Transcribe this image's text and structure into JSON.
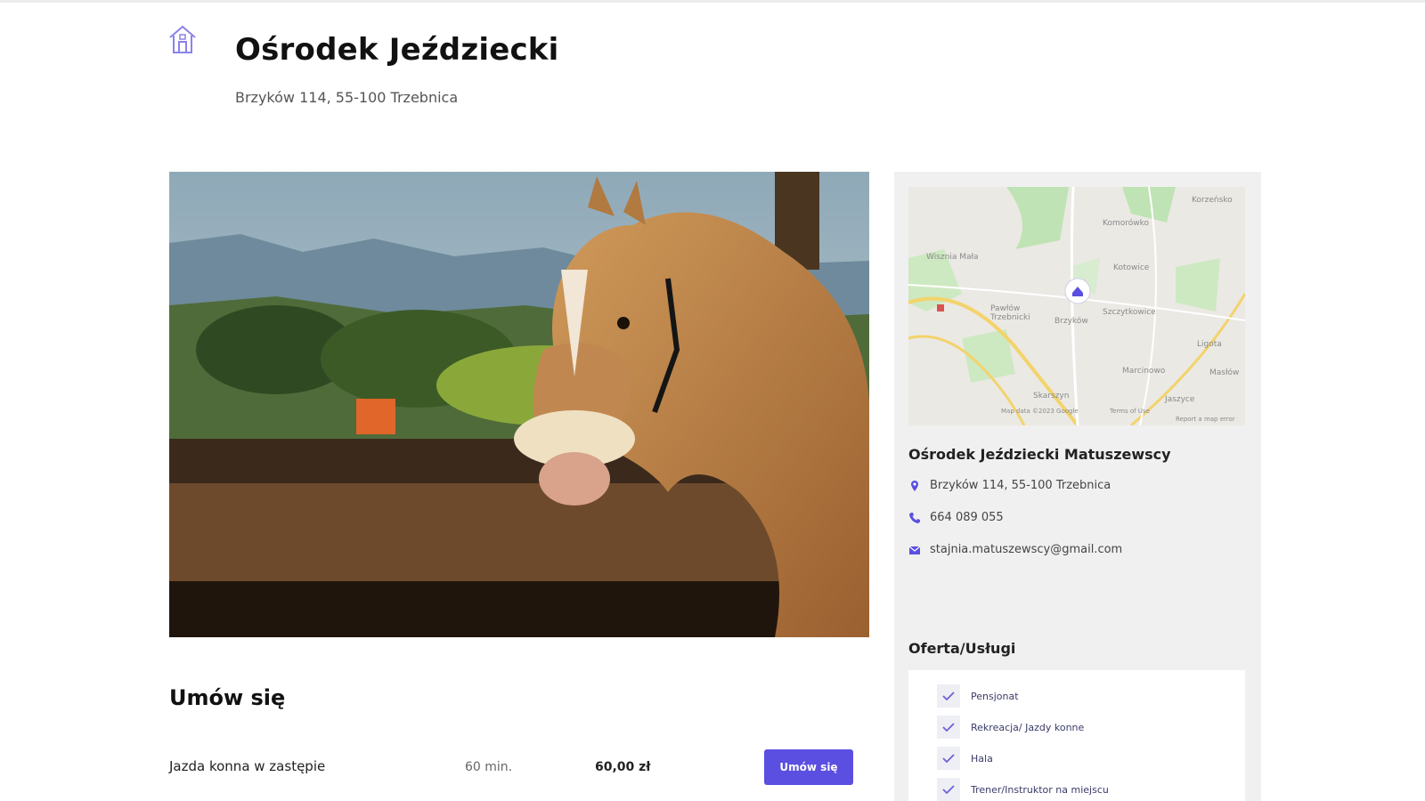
{
  "header": {
    "icon": "home-icon",
    "title": "Ośrodek Jeździecki",
    "address": "Brzyków 114, 55-100 Trzebnica"
  },
  "booking": {
    "heading": "Umów się",
    "services": [
      {
        "name": "Jazda konna w zastępie",
        "duration": "60 min.",
        "price": "60,00 zł",
        "button": "Umów się"
      }
    ]
  },
  "sidebar": {
    "map": {
      "labels": [
        "Korzeńsko",
        "Komorówko",
        "Wisznia Mała",
        "Kotowice",
        "Pawłów Trzebnicki",
        "Brzyków",
        "Szczytkowice",
        "Ligota",
        "Marcinowo",
        "Masłów",
        "Jaszyce",
        "Skarszyn",
        "Map data ©2023 Google",
        "Terms of Use",
        "Report a map error"
      ],
      "accent": "#5a4fe0"
    },
    "business_name": "Ośrodek Jeździecki Matuszewscy",
    "address": "Brzyków 114, 55-100 Trzebnica",
    "phone": "664 089 055",
    "email": "stajnia.matuszewscy@gmail.com",
    "offer_heading": "Oferta/Usługi",
    "offers": [
      "Pensjonat",
      "Rekreacja/ Jazdy konne",
      "Hala",
      "Trener/Instruktor na miejscu"
    ]
  },
  "colors": {
    "accent": "#5a4fe0",
    "sidebar_bg": "#f0f0f0"
  }
}
